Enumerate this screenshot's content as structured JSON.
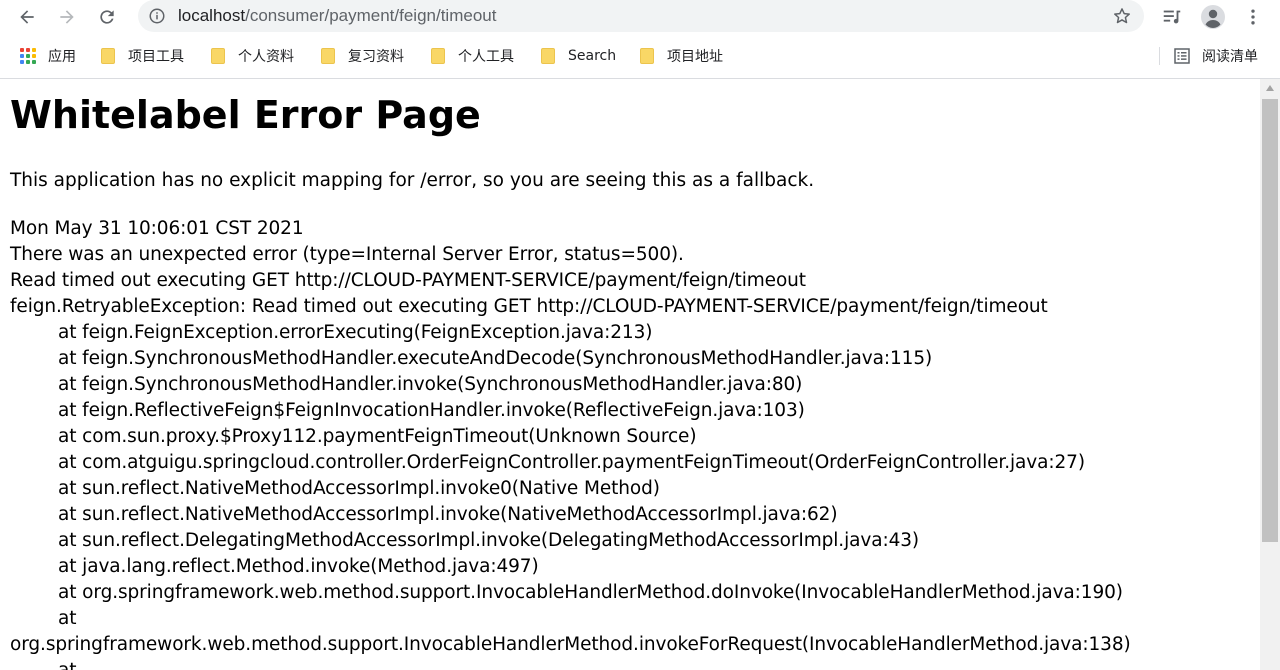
{
  "browser": {
    "url_host": "localhost",
    "url_path": "/consumer/payment/feign/timeout",
    "icons": {
      "back": "arrow-left-icon",
      "forward": "arrow-right-icon",
      "reload": "reload-icon",
      "info": "info-icon",
      "star": "star-icon",
      "media": "media-queue-icon",
      "profile": "account-icon",
      "menu": "kebab-menu-icon"
    }
  },
  "bookmarks": {
    "apps_label": "应用",
    "items": [
      "项目工具",
      "个人资料",
      "复习资料",
      "个人工具",
      "Search",
      "项目地址"
    ],
    "reading_list_label": "阅读清单"
  },
  "page": {
    "title": "Whitelabel Error Page",
    "lead": "This application has no explicit mapping for /error, so you are seeing this as a fallback.",
    "timestamp": "Mon May 31 10:06:01 CST 2021",
    "error_line": "There was an unexpected error (type=Internal Server Error, status=500).",
    "message": "Read timed out executing GET http://CLOUD-PAYMENT-SERVICE/payment/feign/timeout",
    "exception": "feign.RetryableException: Read timed out executing GET http://CLOUD-PAYMENT-SERVICE/payment/feign/timeout",
    "stack": [
      "at feign.FeignException.errorExecuting(FeignException.java:213)",
      "at feign.SynchronousMethodHandler.executeAndDecode(SynchronousMethodHandler.java:115)",
      "at feign.SynchronousMethodHandler.invoke(SynchronousMethodHandler.java:80)",
      "at feign.ReflectiveFeign$FeignInvocationHandler.invoke(ReflectiveFeign.java:103)",
      "at com.sun.proxy.$Proxy112.paymentFeignTimeout(Unknown Source)",
      "at com.atguigu.springcloud.controller.OrderFeignController.paymentFeignTimeout(OrderFeignController.java:27)",
      "at sun.reflect.NativeMethodAccessorImpl.invoke0(Native Method)",
      "at sun.reflect.NativeMethodAccessorImpl.invoke(NativeMethodAccessorImpl.java:62)",
      "at sun.reflect.DelegatingMethodAccessorImpl.invoke(DelegatingMethodAccessorImpl.java:43)",
      "at java.lang.reflect.Method.invoke(Method.java:497)",
      "at org.springframework.web.method.support.InvocableHandlerMethod.doInvoke(InvocableHandlerMethod.java:190)",
      "at"
    ],
    "wrapped_line": "org.springframework.web.method.support.InvocableHandlerMethod.invokeForRequest(InvocableHandlerMethod.java:138)",
    "trailing_line": "at"
  },
  "colors": {
    "omnibox_bg": "#f1f3f4",
    "icon_gray": "#5f6368",
    "folder_yellow": "#f9d766",
    "scroll_track": "#f1f1f1",
    "scroll_thumb": "#c1c1c1"
  }
}
